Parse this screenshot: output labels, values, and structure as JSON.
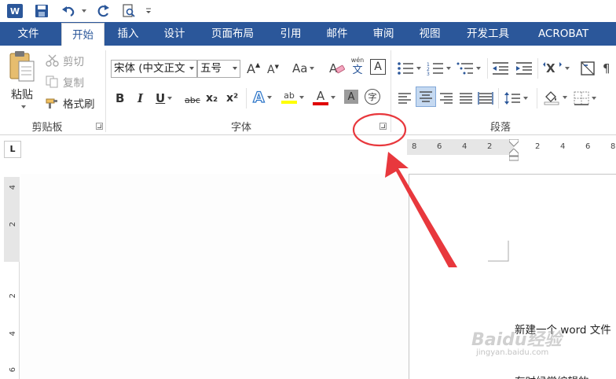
{
  "qat": {
    "word_logo": "W",
    "save": "save-icon",
    "undo": "undo-icon",
    "redo": "redo-icon",
    "preview": "print-preview-icon",
    "customize": "customize-icon"
  },
  "tabs": [
    "文件",
    "开始",
    "插入",
    "设计",
    "页面布局",
    "引用",
    "邮件",
    "审阅",
    "视图",
    "开发工具",
    "ACROBAT"
  ],
  "clipboard": {
    "paste": "粘贴",
    "cut": "剪切",
    "copy": "复制",
    "format_painter": "格式刷",
    "label": "剪贴板"
  },
  "font": {
    "font_name": "宋体 (中文正文",
    "font_size": "五号",
    "label": "字体",
    "grow": "A",
    "shrink": "A",
    "change_case": "Aa",
    "phonetic_top": "wén",
    "phonetic_bottom": "文",
    "border_char": "A",
    "bold": "B",
    "italic": "I",
    "underline": "U",
    "strike": "abc",
    "subscript": "x₂",
    "superscript": "x²",
    "effects": "A",
    "highlight": "ab",
    "font_color": "A",
    "shading": "A",
    "enclose": "字"
  },
  "paragraph": {
    "label": "段落"
  },
  "ruler": {
    "tab_selector": "L",
    "h_numbers": [
      "8",
      "6",
      "4",
      "2",
      "2",
      "4",
      "6",
      "8"
    ],
    "v_numbers": [
      "4",
      "2",
      "2",
      "4",
      "6"
    ]
  },
  "document": {
    "line1": "新建一个 word 文件",
    "line2": "有时候常编辑的，"
  },
  "watermark": {
    "main": "Baidu经验",
    "sub": "jingyan.baidu.com"
  },
  "colors": {
    "ribbon_blue": "#2b579a",
    "annotation_red": "#e8383d",
    "highlight_yellow": "#ffff00",
    "font_red": "#e00000"
  }
}
